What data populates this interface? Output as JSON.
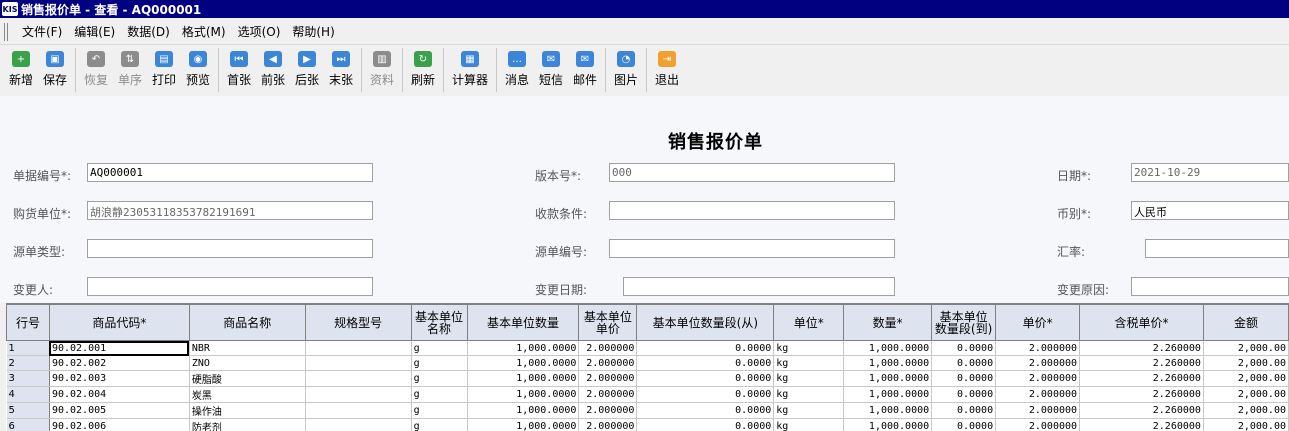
{
  "window": {
    "title": "销售报价单 - 查看 - AQ000001",
    "logo_text": "KIS"
  },
  "menu": [
    "文件(F)",
    "编辑(E)",
    "数据(D)",
    "格式(M)",
    "选项(O)",
    "帮助(H)"
  ],
  "toolbar": [
    {
      "label": "新增",
      "icon": "plus-icon",
      "color": "#3aa04a",
      "enabled": true
    },
    {
      "label": "保存",
      "icon": "save-icon",
      "color": "#3b86d6",
      "enabled": true
    },
    {
      "sep": true
    },
    {
      "label": "恢复",
      "icon": "undo-icon",
      "color": "#8c8c8c",
      "enabled": false
    },
    {
      "label": "单序",
      "icon": "sequence-icon",
      "color": "#8c8c8c",
      "enabled": false
    },
    {
      "label": "打印",
      "icon": "print-icon",
      "color": "#3b86d6",
      "enabled": true
    },
    {
      "label": "预览",
      "icon": "preview-icon",
      "color": "#3b86d6",
      "enabled": true
    },
    {
      "sep": true
    },
    {
      "label": "首张",
      "icon": "first-record-icon",
      "color": "#3b86d6",
      "enabled": true
    },
    {
      "label": "前张",
      "icon": "previous-record-icon",
      "color": "#3b86d6",
      "enabled": true
    },
    {
      "label": "后张",
      "icon": "next-record-icon",
      "color": "#3b86d6",
      "enabled": true
    },
    {
      "label": "末张",
      "icon": "last-record-icon",
      "color": "#3b86d6",
      "enabled": true
    },
    {
      "sep": true
    },
    {
      "label": "资料",
      "icon": "books-icon",
      "color": "#8c8c8c",
      "enabled": false
    },
    {
      "sep": true
    },
    {
      "label": "刷新",
      "icon": "refresh-icon",
      "color": "#3aa04a",
      "enabled": true
    },
    {
      "sep": true
    },
    {
      "label": "计算器",
      "icon": "calculator-icon",
      "color": "#3b86d6",
      "enabled": true,
      "wide": true
    },
    {
      "sep": true
    },
    {
      "label": "消息",
      "icon": "message-icon",
      "color": "#3b86d6",
      "enabled": true
    },
    {
      "label": "短信",
      "icon": "sms-icon",
      "color": "#3b86d6",
      "enabled": true
    },
    {
      "label": "邮件",
      "icon": "mail-icon",
      "color": "#3b86d6",
      "enabled": true
    },
    {
      "sep": true
    },
    {
      "label": "图片",
      "icon": "picture-icon",
      "color": "#3b86d6",
      "enabled": true
    },
    {
      "sep": true
    },
    {
      "label": "退出",
      "icon": "exit-icon",
      "color": "#f0a030",
      "enabled": true
    }
  ],
  "form": {
    "title": "销售报价单",
    "bill_no_label": "单据编号*:",
    "bill_no": "AQ000001",
    "version_label": "版本号*:",
    "version": "000",
    "date_label": "日期*:",
    "date": "2021-10-29",
    "customer_label": "购货单位*:",
    "customer": "胡浪静230531183537821916​91",
    "terms_label": "收款条件:",
    "terms": "",
    "currency_label": "币别*:",
    "currency": "人民币",
    "source_type_label": "源单类型:",
    "source_type": "",
    "source_no_label": "源单编号:",
    "source_no": "",
    "rate_label": "汇率:",
    "rate": "",
    "changer_label": "变更人:",
    "changer": "",
    "change_date_label": "变更日期:",
    "change_date": "",
    "change_reason_label": "变更原因:",
    "change_reason": ""
  },
  "grid": {
    "columns": [
      "行号",
      "商品代码*",
      "商品名称",
      "规格型号",
      "基本单位名称",
      "基本单位数量",
      "基本单位单价",
      "基本单位数量段(从)",
      "单位*",
      "数量*",
      "基本单位数量段(到)",
      "单价*",
      "含税单价*",
      "金额"
    ],
    "rows": [
      [
        "1",
        "90.02.001",
        "NBR",
        "",
        "g",
        "1,000.0000",
        "2.000000",
        "0.0000",
        "kg",
        "1,000.0000",
        "0.0000",
        "2.000000",
        "2.260000",
        "2,000.00"
      ],
      [
        "2",
        "90.02.002",
        "ZNO",
        "",
        "g",
        "1,000.0000",
        "2.000000",
        "0.0000",
        "kg",
        "1,000.0000",
        "0.0000",
        "2.000000",
        "2.260000",
        "2,000.00"
      ],
      [
        "3",
        "90.02.003",
        "硬脂酸",
        "",
        "g",
        "1,000.0000",
        "2.000000",
        "0.0000",
        "kg",
        "1,000.0000",
        "0.0000",
        "2.000000",
        "2.260000",
        "2,000.00"
      ],
      [
        "4",
        "90.02.004",
        "炭黑",
        "",
        "g",
        "1,000.0000",
        "2.000000",
        "0.0000",
        "kg",
        "1,000.0000",
        "0.0000",
        "2.000000",
        "2.260000",
        "2,000.00"
      ],
      [
        "5",
        "90.02.005",
        "操作油",
        "",
        "g",
        "1,000.0000",
        "2.000000",
        "0.0000",
        "kg",
        "1,000.0000",
        "0.0000",
        "2.000000",
        "2.260000",
        "2,000.00"
      ],
      [
        "6",
        "90.02.006",
        "防老剂",
        "",
        "g",
        "1,000.0000",
        "2.000000",
        "0.0000",
        "kg",
        "1,000.0000",
        "0.0000",
        "2.000000",
        "2.260000",
        "2,000.00"
      ]
    ]
  }
}
